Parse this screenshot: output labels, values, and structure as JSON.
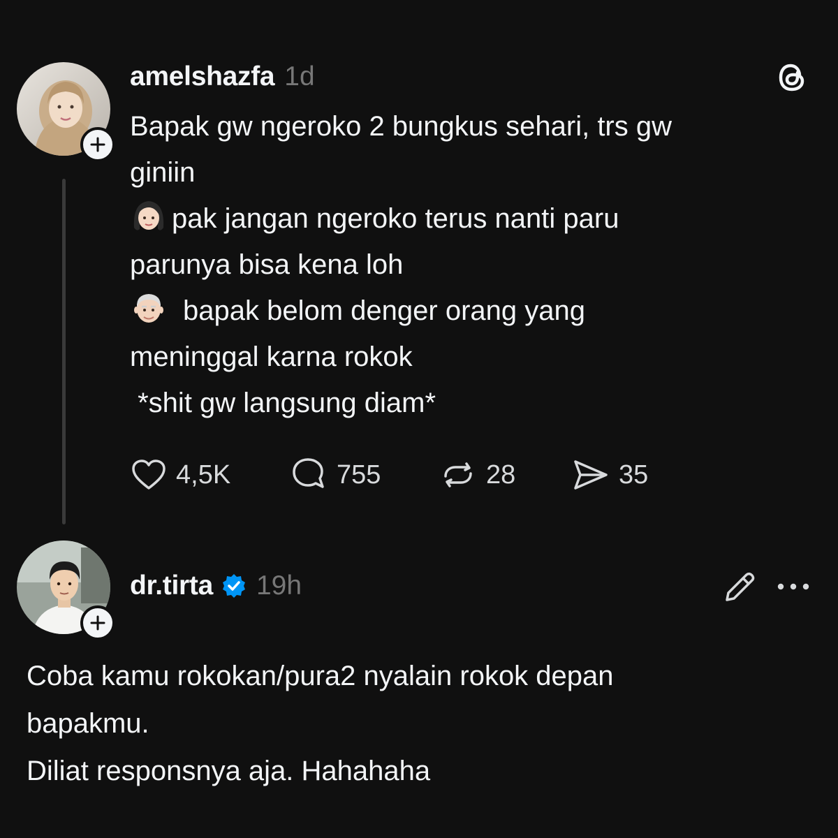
{
  "post": {
    "author": {
      "username": "amelshazfa",
      "time": "1d",
      "avatar_icon": "user-avatar-hijab"
    },
    "lines": [
      "Bapak gw ngeroko 2 bungkus sehari, trs gw",
      "giniin",
      "pak jangan ngeroko terus nanti paru",
      "parunya bisa kena loh",
      "bapak belom denger orang yang",
      "meninggal karna rokok",
      " *shit gw langsung diam*"
    ],
    "emoji_girl": "woman-emoji",
    "emoji_old_man": "old-man-emoji",
    "stats": {
      "likes": "4,5K",
      "replies": "755",
      "reposts": "28",
      "shares": "35"
    },
    "platform_icon": "threads-logo"
  },
  "reply": {
    "author": {
      "username": "dr.tirta",
      "time": "19h",
      "verified": true,
      "avatar_icon": "user-avatar-man"
    },
    "lines": [
      "Coba kamu rokokan/pura2 nyalain rokok depan",
      "bapakmu.",
      "Diliat responsnya aja. Hahahaha"
    ]
  },
  "colors": {
    "background": "#101010",
    "text": "#f3f5f7",
    "muted": "#777777",
    "verified": "#0095f6"
  }
}
